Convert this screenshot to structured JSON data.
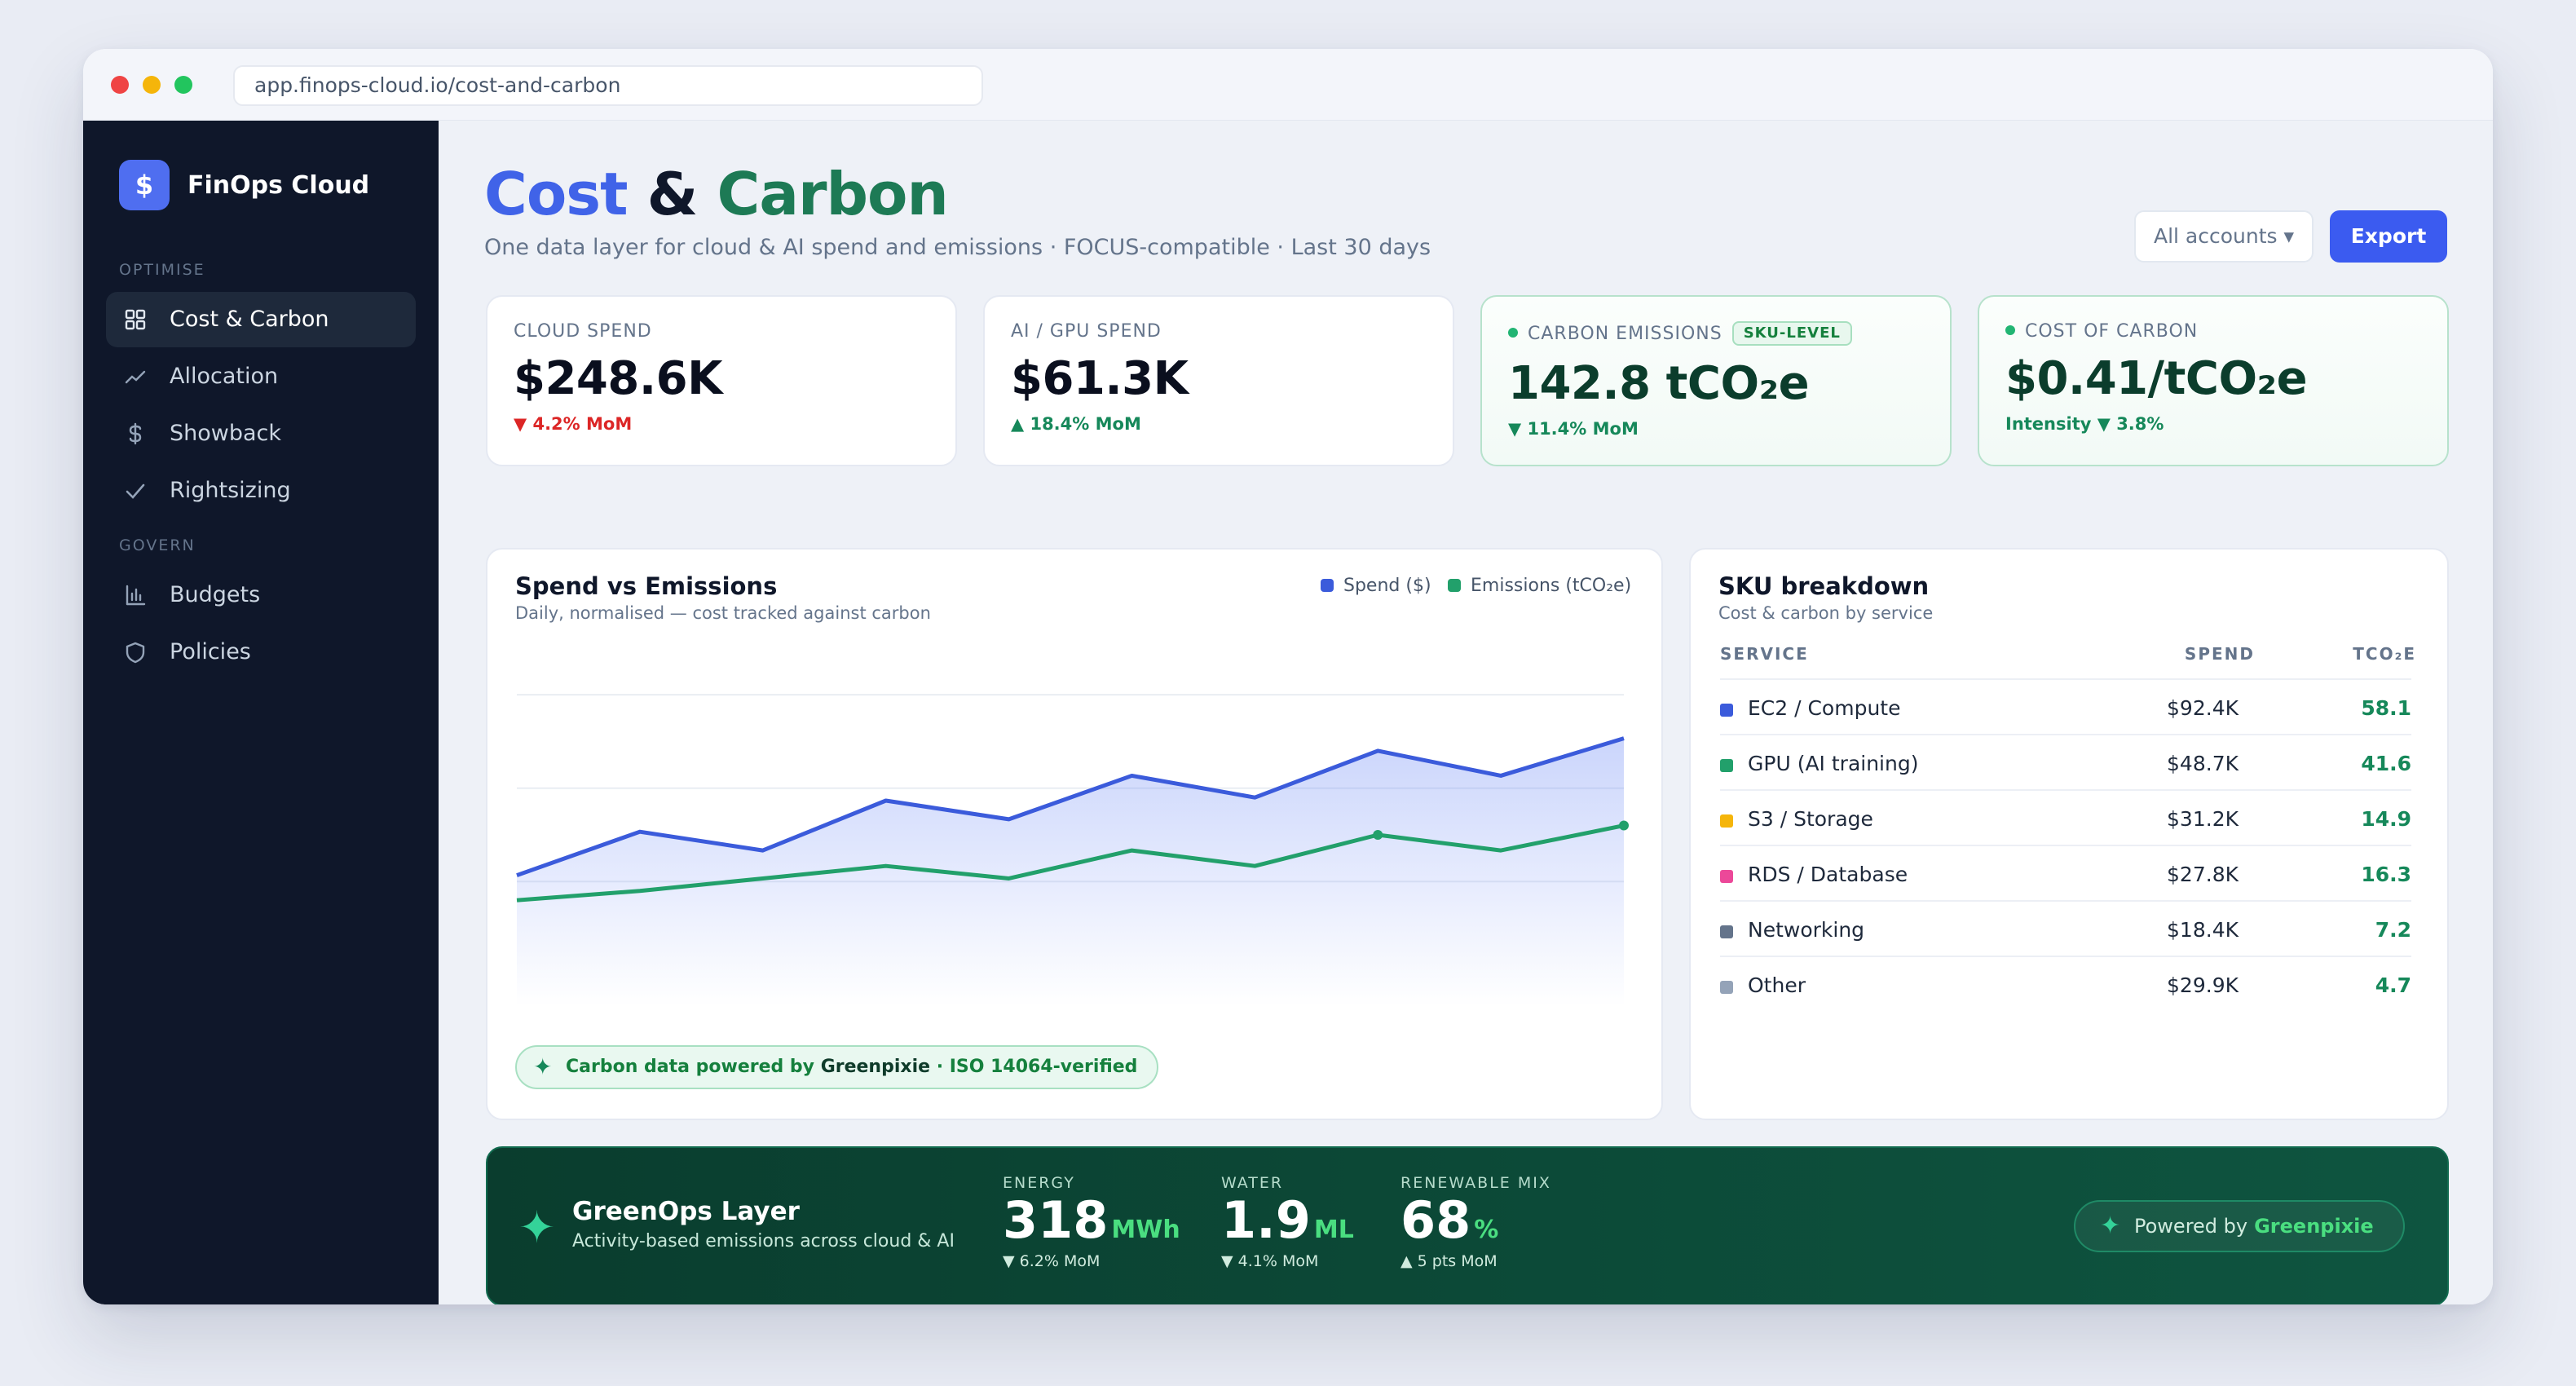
{
  "browser": {
    "url": "app.finops-cloud.io/cost-and-carbon"
  },
  "sidebar": {
    "brand": {
      "logo": "$",
      "name": "FinOps Cloud"
    },
    "sections": [
      {
        "title": "OPTIMISE",
        "items": [
          {
            "label": "Cost & Carbon",
            "icon": "grid-icon",
            "active": true
          },
          {
            "label": "Allocation",
            "icon": "trend-icon"
          },
          {
            "label": "Showback",
            "icon": "currency-icon"
          },
          {
            "label": "Rightsizing",
            "icon": "check-icon"
          }
        ]
      },
      {
        "title": "GOVERN",
        "items": [
          {
            "label": "Budgets",
            "icon": "bar-chart-icon"
          },
          {
            "label": "Policies",
            "icon": "shield-icon"
          }
        ]
      }
    ]
  },
  "header": {
    "title_part1": "Cost",
    "title_part2": "&",
    "title_part3": "Carbon",
    "subtitle": "One data layer for cloud & AI spend and emissions · FOCUS-compatible · Last 30 days",
    "accounts_label": "All accounts ▾",
    "export_label": "Export"
  },
  "kpis": [
    {
      "label": "CLOUD SPEND",
      "value": "$248.6K",
      "delta": "▼ 4.2% MoM",
      "tone": "red"
    },
    {
      "label": "AI / GPU SPEND",
      "value": "$61.3K",
      "delta": "▲ 18.4% MoM",
      "tone": "green"
    },
    {
      "label": "CARBON EMISSIONS",
      "badge": "SKU-LEVEL",
      "value": "142.8 tCO₂e",
      "delta": "▼ 11.4% MoM",
      "tone": "green"
    },
    {
      "label": "COST OF CARBON",
      "value": "$0.41/tCO₂e",
      "delta": "Intensity ▼ 3.8%",
      "tone": "green"
    }
  ],
  "spend_chart": {
    "title": "Spend vs Emissions",
    "subtitle": "Daily, normalised — cost tracked against carbon",
    "legend_spend": "Spend ($)",
    "legend_emissions": "Emissions (tCO₂e)",
    "pill_prefix": "Carbon data powered by",
    "pill_brand": "Greenpixie",
    "pill_suffix": "· ISO 14064-verified",
    "colors": {
      "spend": "#3b5bdb",
      "emissions": "#22a06b"
    }
  },
  "chart_data": {
    "type": "line",
    "x": [
      1,
      2,
      3,
      4,
      5,
      6,
      7,
      8,
      9,
      10
    ],
    "series": [
      {
        "name": "Spend ($)",
        "values": [
          32,
          46,
          40,
          56,
          50,
          64,
          57,
          72,
          64,
          76
        ]
      },
      {
        "name": "Emissions (tCO₂e)",
        "values": [
          24,
          27,
          31,
          35,
          31,
          40,
          35,
          45,
          40,
          48
        ]
      }
    ],
    "ylim": [
      -10,
      100
    ],
    "grid": true,
    "legend": "top-right"
  },
  "sku": {
    "title": "SKU breakdown",
    "subtitle": "Cost & carbon by service",
    "headers": {
      "service": "SERVICE",
      "spend": "SPEND",
      "co2": "TCO₂E"
    },
    "rows": [
      {
        "service": "EC2 / Compute",
        "spend": "$92.4K",
        "co2": "58.1",
        "color": "#3b5bdb"
      },
      {
        "service": "GPU (AI training)",
        "spend": "$48.7K",
        "co2": "41.6",
        "color": "#22a06b"
      },
      {
        "service": "S3 / Storage",
        "spend": "$31.2K",
        "co2": "14.9",
        "color": "#f5b50a"
      },
      {
        "service": "RDS / Database",
        "spend": "$27.8K",
        "co2": "16.3",
        "color": "#ec4899"
      },
      {
        "service": "Networking",
        "spend": "$18.4K",
        "co2": "7.2",
        "color": "#64748b"
      },
      {
        "service": "Other",
        "spend": "$29.9K",
        "co2": "4.7",
        "color": "#94a3b8"
      }
    ]
  },
  "greenops": {
    "title": "GreenOps Layer",
    "subtitle": "Activity-based emissions across cloud & AI",
    "metrics": [
      {
        "label": "ENERGY",
        "value": "318",
        "unit": "MWh",
        "delta": "▼ 6.2% MoM"
      },
      {
        "label": "WATER",
        "value": "1.9",
        "unit": "ML",
        "delta": "▼ 4.1% MoM"
      },
      {
        "label": "RENEWABLE MIX",
        "value": "68",
        "unit": "%",
        "delta": "▲ 5 pts MoM"
      }
    ],
    "powered_prefix": "Powered by",
    "powered_brand": "Greenpixie"
  }
}
